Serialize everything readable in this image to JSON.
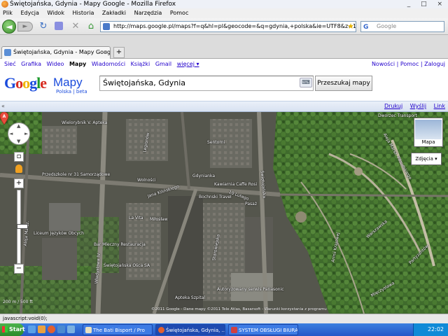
{
  "window": {
    "title": "Świętojańska, Gdynia - Mapy Google - Mozilla Firefox",
    "controls": "_ □ ×"
  },
  "menu": [
    "Plik",
    "Edycja",
    "Widok",
    "Historia",
    "Zakładki",
    "Narzędzia",
    "Pomoc"
  ],
  "nav": {
    "url": "http://maps.google.pl/maps?f=q&hl=pl&geocode=&q=gdynia,+polska&ie=UTF8&z=14",
    "search_placeholder": "Google",
    "search_engine": "G"
  },
  "tab": {
    "label": "Świętojańska, Gdynia - Mapy Google",
    "close": "×",
    "new": "+"
  },
  "gbar": {
    "items": [
      "Sieć",
      "Grafika",
      "Wideo",
      "Mapy",
      "Wiadomości",
      "Książki",
      "Gmail",
      "więcej ▾"
    ],
    "current": "Mapy",
    "right": "Nowości | Pomoc | Zaloguj"
  },
  "logo": {
    "letters": [
      "G",
      "o",
      "o",
      "g",
      "l",
      "e"
    ],
    "product": "Mapy",
    "sub": "Polska | beta"
  },
  "search": {
    "value": "Świętojańska, Gdynia",
    "keyboard": "⌨",
    "button": "Przeszukaj mapy"
  },
  "toolbar": {
    "collapse": "«",
    "print": "Drukuj",
    "send": "Wyślij",
    "link": "Link"
  },
  "map": {
    "controls": {
      "zoom_in": "+",
      "zoom_out": "−",
      "up": "▲",
      "down": "▼",
      "left": "◄",
      "right": "►"
    },
    "type_button": "Mapa",
    "photos_button": "Zdjęcia",
    "marker": "A",
    "labels": [
      "Wielorybnik V. Apteka",
      "Przedszkole nr 31 Samorządowe",
      "Liceum Języków Obcych",
      "Bar Mleczny Restauracja",
      "Miłosław",
      "La Vita",
      "Gdynianka",
      "Kawiarnia Caffe Rosi",
      "Bochnski Travel",
      "Sentorni",
      "Świętojańska Ośca SA",
      "Pasaż",
      "Autoryzowany serwis Panasonic",
      "Apteka Szpital",
      "Dworzec Transport"
    ],
    "streets": [
      "Wolności",
      "Jana Kilińskiego",
      "Władysława IV",
      "Świętojańska",
      "Starowiejska",
      "Aleja Marsz.",
      "Legionów",
      "Armii Krajowej",
      "Warszawska",
      "Partyzantów",
      "Aleja Marsz. Piłsudskiego",
      "10 Lutego",
      "Mięczysława"
    ],
    "scale": "200 m / 500 ft",
    "copyright": "©2011 Google - Dane mapy ©2011 Tele Atlas, Basarsoft - Warunki korzystania z programu"
  },
  "status": "javascript:void(0);",
  "taskbar": {
    "start": "Start",
    "tasks": [
      "The Bati Bisport / Pro",
      "Świętojańska, Gdynia, ...",
      "SYSTEM OBSŁUGI BIURA ..."
    ],
    "time": "22:02"
  }
}
